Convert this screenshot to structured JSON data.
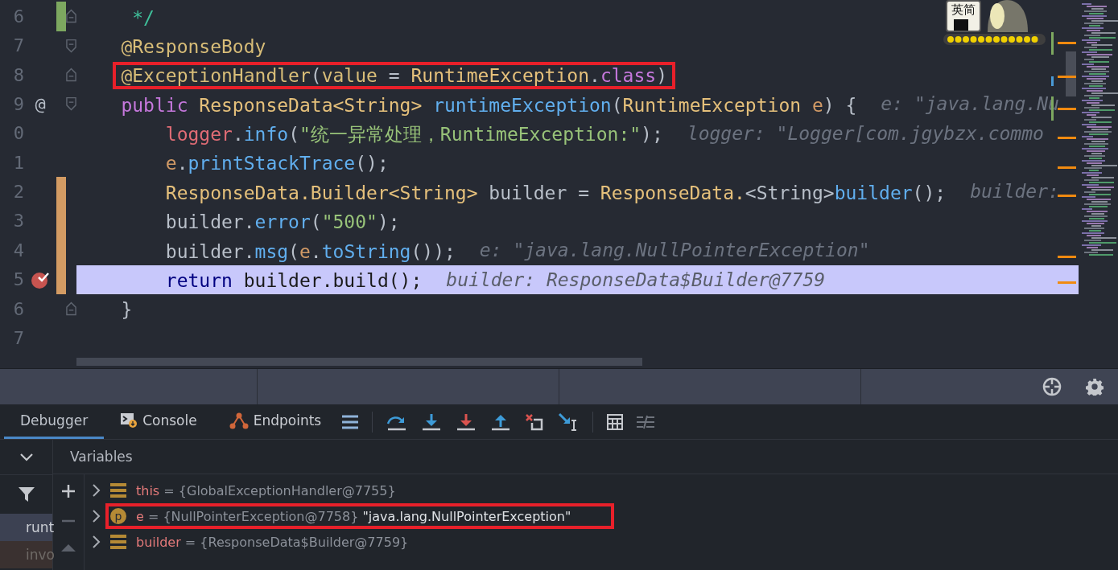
{
  "editor": {
    "lines": [
      {
        "number": "6",
        "color": "#7da860",
        "fold_start": false,
        "fold_end": true,
        "current": false,
        "outlined": false,
        "breakpoint": false,
        "tokens": [
          {
            "kind": "comment",
            "text": "     */"
          }
        ]
      },
      {
        "number": "7",
        "fold_start": true,
        "fold_end": false,
        "current": false,
        "outlined": false,
        "breakpoint": false,
        "tokens": [
          {
            "kind": "annotation",
            "text": "    @ResponseBody"
          }
        ]
      },
      {
        "number": "8",
        "fold_start": false,
        "fold_end": true,
        "current": false,
        "outlined": true,
        "breakpoint": false,
        "tokens": [
          {
            "kind": "annotation",
            "text": "    @ExceptionHandler"
          },
          {
            "kind": "plain",
            "text": "("
          },
          {
            "kind": "annotation",
            "text": "value"
          },
          {
            "kind": "plain",
            "text": " = "
          },
          {
            "kind": "type",
            "text": "RuntimeException"
          },
          {
            "kind": "plain",
            "text": "."
          },
          {
            "kind": "keyword",
            "text": "class"
          },
          {
            "kind": "plain",
            "text": ")"
          }
        ]
      },
      {
        "number": "9",
        "gutter_mark": "@",
        "fold_start": true,
        "fold_end": false,
        "current": false,
        "outlined": false,
        "breakpoint": false,
        "tokens": [
          {
            "kind": "keyword",
            "text": "    public"
          },
          {
            "kind": "type",
            "text": " ResponseData<String>"
          },
          {
            "kind": "method",
            "text": " runtimeException"
          },
          {
            "kind": "plain",
            "text": "("
          },
          {
            "kind": "type",
            "text": "RuntimeException"
          },
          {
            "kind": "param",
            "text": " e"
          },
          {
            "kind": "plain",
            "text": ") {"
          }
        ],
        "hint": "e: \"java.lang.Nu"
      },
      {
        "number": "0",
        "fold_start": false,
        "fold_end": false,
        "current": false,
        "outlined": false,
        "breakpoint": false,
        "tokens": [
          {
            "kind": "field",
            "text": "        logger"
          },
          {
            "kind": "plain",
            "text": "."
          },
          {
            "kind": "method",
            "text": "info"
          },
          {
            "kind": "plain",
            "text": "("
          },
          {
            "kind": "string",
            "text": "\"统一异常处理，RuntimeException:\""
          },
          {
            "kind": "plain",
            "text": ");"
          }
        ],
        "hint": "logger: \"Logger[com.jgybzx.commo"
      },
      {
        "number": "1",
        "fold_start": false,
        "fold_end": false,
        "current": false,
        "outlined": false,
        "breakpoint": false,
        "tokens": [
          {
            "kind": "param",
            "text": "        e"
          },
          {
            "kind": "plain",
            "text": "."
          },
          {
            "kind": "method",
            "text": "printStackTrace"
          },
          {
            "kind": "plain",
            "text": "();"
          }
        ]
      },
      {
        "number": "2",
        "color": "#d39b63",
        "fold_start": false,
        "fold_end": false,
        "current": false,
        "outlined": false,
        "breakpoint": false,
        "tokens": [
          {
            "kind": "type",
            "text": "        ResponseData.Builder<String>"
          },
          {
            "kind": "plain",
            "text": " builder = "
          },
          {
            "kind": "type",
            "text": "ResponseData."
          },
          {
            "kind": "plain",
            "text": "<String>"
          },
          {
            "kind": "method",
            "text": "builder"
          },
          {
            "kind": "plain",
            "text": "();"
          }
        ],
        "hint": "builder:"
      },
      {
        "number": "3",
        "color": "#d39b63",
        "fold_start": false,
        "fold_end": false,
        "current": false,
        "outlined": false,
        "breakpoint": false,
        "tokens": [
          {
            "kind": "plain",
            "text": "        builder."
          },
          {
            "kind": "method",
            "text": "error"
          },
          {
            "kind": "plain",
            "text": "("
          },
          {
            "kind": "string",
            "text": "\"500\""
          },
          {
            "kind": "plain",
            "text": ");"
          }
        ]
      },
      {
        "number": "4",
        "color": "#d39b63",
        "fold_start": false,
        "fold_end": false,
        "current": false,
        "outlined": false,
        "breakpoint": false,
        "tokens": [
          {
            "kind": "plain",
            "text": "        builder."
          },
          {
            "kind": "method",
            "text": "msg"
          },
          {
            "kind": "plain",
            "text": "("
          },
          {
            "kind": "param",
            "text": "e"
          },
          {
            "kind": "plain",
            "text": "."
          },
          {
            "kind": "method",
            "text": "toString"
          },
          {
            "kind": "plain",
            "text": "());"
          }
        ],
        "hint": "e: \"java.lang.NullPointerException\""
      },
      {
        "number": "5",
        "color": "#d39b63",
        "fold_start": false,
        "fold_end": false,
        "current": true,
        "outlined": false,
        "breakpoint": true,
        "tokens": [
          {
            "kind": "keyword",
            "text": "        return"
          },
          {
            "kind": "plain",
            "text": " builder."
          },
          {
            "kind": "method",
            "text": "build"
          },
          {
            "kind": "plain",
            "text": "();"
          }
        ],
        "hint": "builder: ResponseData$Builder@7759"
      },
      {
        "number": "6",
        "fold_start": false,
        "fold_end": true,
        "current": false,
        "outlined": false,
        "breakpoint": false,
        "tokens": [
          {
            "kind": "plain",
            "text": "    }"
          }
        ]
      },
      {
        "number": "7",
        "fold_start": false,
        "fold_end": false,
        "current": false,
        "breakpoint": false
      }
    ]
  },
  "ime": {
    "label": "英简"
  },
  "debugger": {
    "tabs": [
      {
        "label": "Debugger",
        "kind": "plain",
        "selected": true
      },
      {
        "label": "Console",
        "kind": "console",
        "selected": false
      },
      {
        "label": "Endpoints",
        "kind": "endpoints",
        "selected": false
      }
    ],
    "variables_title": "Variables",
    "frames": [
      {
        "label": "runt",
        "selected": true,
        "library": false
      },
      {
        "label": "invo",
        "selected": false,
        "library": true
      }
    ],
    "variables": [
      {
        "kind": "field",
        "name": "this",
        "assign": "=",
        "value": "{GlobalExceptionHandler@7755}",
        "outlined": false
      },
      {
        "kind": "parameter",
        "badge": "p",
        "name": "e",
        "assign": "=",
        "value": "{NullPointerException@7758}",
        "string": "\"java.lang.NullPointerException\"",
        "outlined": true
      },
      {
        "kind": "field",
        "name": "builder",
        "assign": "=",
        "value": "{ResponseData$Builder@7759}",
        "outlined": false
      }
    ]
  }
}
